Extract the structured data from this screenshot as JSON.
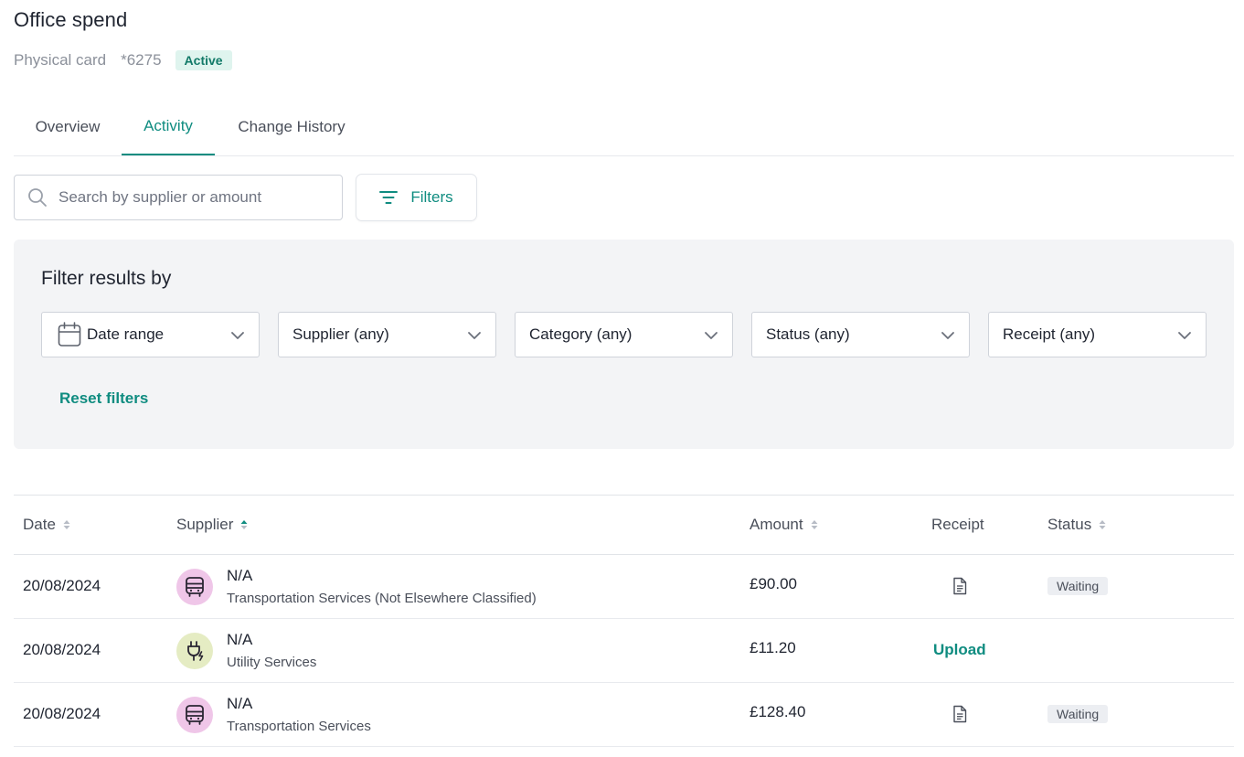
{
  "card": {
    "title": "Office spend",
    "type": "Physical card",
    "last4": "*6275",
    "status": "Active"
  },
  "tabs": [
    {
      "label": "Overview"
    },
    {
      "label": "Activity"
    },
    {
      "label": "Change History"
    }
  ],
  "active_tab": "Activity",
  "search": {
    "placeholder": "Search by supplier or amount",
    "value": ""
  },
  "filters_button": {
    "label": "Filters"
  },
  "filter_panel": {
    "title": "Filter results by",
    "date_range": "Date range",
    "supplier": "Supplier (any)",
    "category": "Category (any)",
    "status": "Status (any)",
    "receipt": "Receipt (any)",
    "reset_label": "Reset filters"
  },
  "table": {
    "columns": {
      "date": "Date",
      "supplier": "Supplier",
      "amount": "Amount",
      "receipt": "Receipt",
      "status": "Status"
    },
    "sorted_by": "Supplier",
    "sort_direction": "ascending",
    "rows": [
      {
        "date": "20/08/2024",
        "supplier": "N/A",
        "category": "Transportation Services (Not Elsewhere Classified)",
        "category_icon": "bus-icon",
        "amount": "£90.00",
        "receipt": "document-icon",
        "status": "Waiting"
      },
      {
        "date": "20/08/2024",
        "supplier": "N/A",
        "category": "Utility Services",
        "category_icon": "plug-icon",
        "amount": "£11.20",
        "receipt": "Upload",
        "status": ""
      },
      {
        "date": "20/08/2024",
        "supplier": "N/A",
        "category": "Transportation Services",
        "category_icon": "bus-icon",
        "amount": "£128.40",
        "receipt": "document-icon",
        "status": "Waiting"
      }
    ]
  },
  "colors": {
    "accent": "#0f8c80",
    "active_badge_bg": "#dff4ee",
    "panel_bg": "#f3f4f6",
    "transport_avatar_bg": "#efc6e8",
    "utility_avatar_bg": "#e5ecc3"
  }
}
